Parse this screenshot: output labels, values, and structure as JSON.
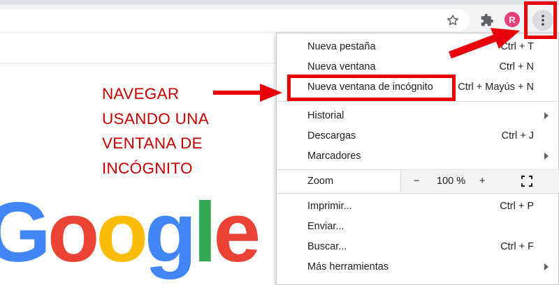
{
  "browser": {
    "avatar_letter": "R",
    "avatar_color": "#e5407b",
    "icons": [
      "star-icon",
      "puzzle-icon",
      "kebab-menu-icon"
    ]
  },
  "menu": {
    "items": [
      {
        "label": "Nueva pestaña",
        "shortcut": "Ctrl + T"
      },
      {
        "label": "Nueva ventana",
        "shortcut": "Ctrl + N"
      },
      {
        "label": "Nueva ventana de incógnito",
        "shortcut": "Ctrl + Mayús + N"
      },
      {
        "label": "Historial",
        "shortcut": ""
      },
      {
        "label": "Descargas",
        "shortcut": "Ctrl + J"
      },
      {
        "label": "Marcadores",
        "shortcut": ""
      },
      {
        "label": "Imprimir...",
        "shortcut": "Ctrl + P"
      },
      {
        "label": "Enviar...",
        "shortcut": ""
      },
      {
        "label": "Buscar...",
        "shortcut": "Ctrl + F"
      },
      {
        "label": "Más herramientas",
        "shortcut": ""
      }
    ],
    "zoom": {
      "label": "Zoom",
      "minus": "−",
      "value": "100 %",
      "plus": "+"
    }
  },
  "annotation": {
    "lines": [
      "NAVEGAR",
      "USANDO UNA",
      "VENTANA DE",
      "INCÓGNITO"
    ],
    "color": "#e8000b"
  },
  "google_logo": {
    "letters": [
      "G",
      "o",
      "o",
      "g",
      "l",
      "e"
    ],
    "colors": [
      "#4285f4",
      "#ea4335",
      "#fbbc05",
      "#4285f4",
      "#34a853",
      "#ea4335"
    ]
  }
}
